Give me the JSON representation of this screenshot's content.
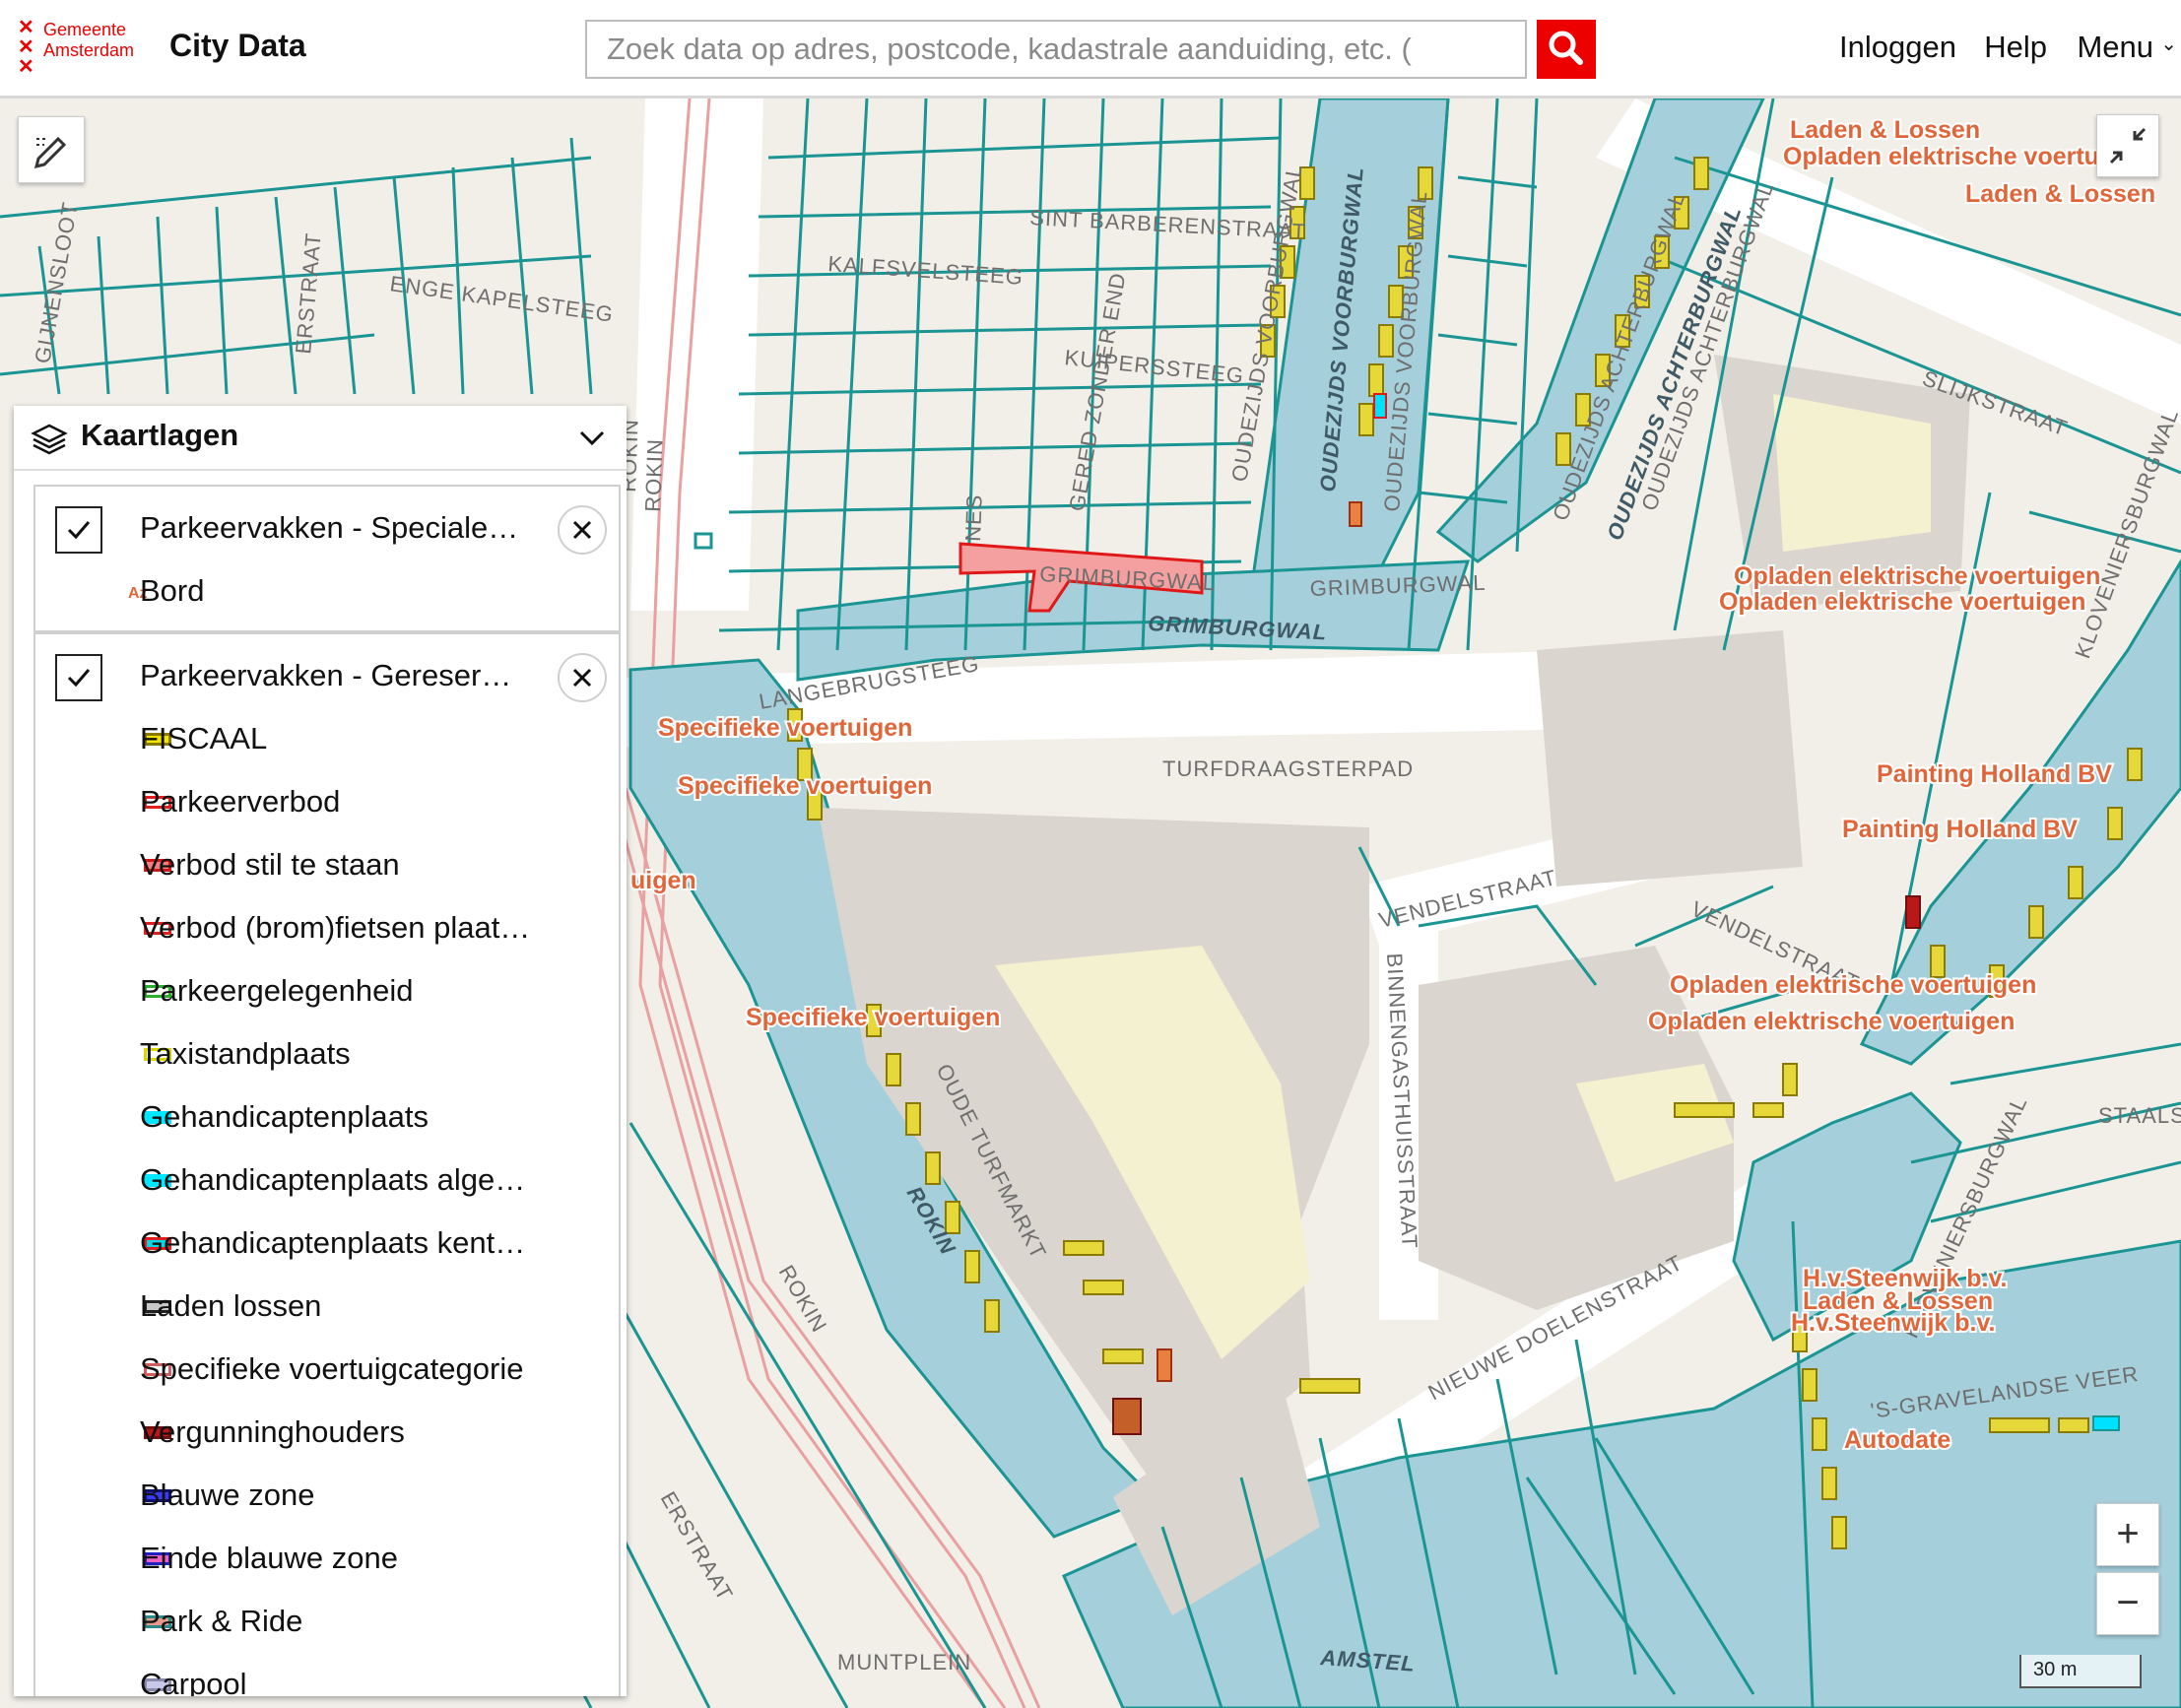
{
  "header": {
    "logo_line1": "Gemeente",
    "logo_line2": "Amsterdam",
    "site_title": "City Data",
    "search_placeholder": "Zoek data op adres, postcode, kadastrale aanduiding, etc. (",
    "nav": {
      "login": "Inloggen",
      "help": "Help",
      "menu": "Menu"
    }
  },
  "map": {
    "street_labels": [
      "SINT BARBERENSTRAAT",
      "KALFSVELSTEEG",
      "ENGE KAPELSTEEG",
      "KUIPERSSTEEG",
      "GERED ZONDER END",
      "NES",
      "ROKIN",
      "LANGEBRUGSTEEG",
      "GRIMBURGWAL",
      "GRIMBURGWAL",
      "GRIMBURGWAL",
      "OUDEZIJDS VOORBURGWAL",
      "OUDEZIJDS VOORBURGWAL",
      "OUDEZIJDS VOORBURGWAL",
      "OUDEZIJDS ACHTERBURGWAL",
      "OUDEZIJDS ACHTERBURGWAL",
      "OUDEZIJDS ACHTERBURGWAL",
      "SLIJKSTRAAT",
      "TURFDRAAGSTERPAD",
      "VENDELSTRAAT",
      "VENDELSTRAAT",
      "BINNENGASTHUISSTRAAT",
      "OUDE TURFMARKT",
      "ROKIN",
      "ROKIN",
      "NIEUWE DOELENSTRAAT",
      "KLOVENIERSBURGWAL",
      "KLOVENIERSBURGWAL",
      "STAALSTRAAT",
      "'S-GRAVELANDSE VEER",
      "MUNTPLEIN",
      "AMSTEL",
      "ERSTRAAT",
      "ERSTRAAT",
      "GIJNENSLOOT"
    ],
    "parking_labels": [
      "Laden & Lossen",
      "Opladen elektrische voertuigen",
      "Laden & Lossen",
      "Opladen elektrische voertuigen",
      "Opladen elektrische voertuigen",
      "Specifieke voertuigen",
      "Specifieke voertuigen",
      "uigen",
      "Painting Holland BV",
      "Painting Holland BV",
      "Opladen elektrische voertuigen",
      "Opladen elektrische voertuigen",
      "Specifieke voertuigen",
      "H.v.Steenwijk b.v.",
      "Laden & Lossen",
      "H.v.Steenwijk b.v.",
      "Autodate"
    ],
    "scale": "30 m",
    "zoom_in": "+",
    "zoom_out": "−",
    "icons": {
      "draw": "draw-tool-icon",
      "collapse": "collapse-icon",
      "search": "search-icon"
    }
  },
  "layers_panel": {
    "title": "Kaartlagen",
    "groups": [
      {
        "title": "Parkeervakken - Speciale…",
        "items": [
          {
            "label": "Bord",
            "symbol": "Az"
          }
        ]
      },
      {
        "title": "Parkeervakken - Gereser…",
        "items": [
          {
            "label": "FISCAAL",
            "fill": "#f2e600",
            "stroke": "#8a7a00"
          },
          {
            "label": "Parkeerverbod",
            "fill": "#ffffff",
            "stroke": "#e02020"
          },
          {
            "label": "Verbod stil te staan",
            "fill": "#f08080",
            "stroke": "#d01818"
          },
          {
            "label": "Verbod (brom)fietsen plaat…",
            "fill": "#ffffff",
            "stroke": "#e02020"
          },
          {
            "label": "Parkeergelegenheid",
            "fill": "#ffffff",
            "stroke": "#2ab02a"
          },
          {
            "label": "Taxistandplaats",
            "fill": "#ffffff",
            "stroke": "#d8d800"
          },
          {
            "label": "Gehandicaptenplaats",
            "fill": "#00e8ff",
            "stroke": "#00e8ff"
          },
          {
            "label": "Gehandicaptenplaats alge…",
            "fill": "#00e8ff",
            "stroke": "#00e8ff"
          },
          {
            "label": "Gehandicaptenplaats kent…",
            "fill": "#00d8e8",
            "stroke": "#e02020"
          },
          {
            "label": "Laden lossen",
            "fill": "#c8c8c8",
            "stroke": "#222222"
          },
          {
            "label": "Specifieke voertuigcategorie",
            "fill": "#ffffff",
            "stroke": "#d06060"
          },
          {
            "label": "Vergunninghouders",
            "fill": "#b81818",
            "stroke": "#701010"
          },
          {
            "label": "Blauwe zone",
            "fill": "#3a3af0",
            "stroke": "#101070"
          },
          {
            "label": "Einde blauwe zone",
            "fill": "#f060c0",
            "stroke": "#2020c0"
          },
          {
            "label": "Park & Ride",
            "fill": "#e89a8a",
            "stroke": "#2a8a8a"
          },
          {
            "label": "Carpool",
            "fill": "#c8c8e8",
            "stroke": "#8a8aaa"
          }
        ]
      }
    ]
  },
  "colors": {
    "water": "#a6cfdc",
    "parcel_line": "#1a9593",
    "street": "#ffffff",
    "brand_red": "#ec0000",
    "label_orange": "#e0663a"
  }
}
